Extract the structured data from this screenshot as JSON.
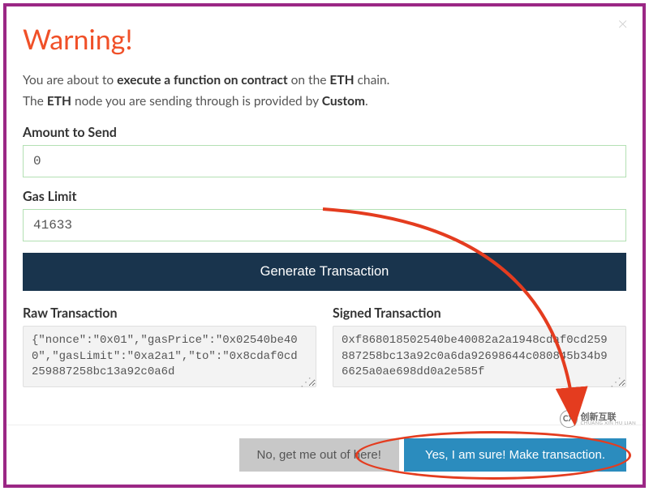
{
  "modal": {
    "title": "Warning!",
    "close_glyph": "×",
    "desc_line1_pre": "You are about to ",
    "desc_line1_bold": "execute a function on contract",
    "desc_line1_mid": " on the ",
    "desc_line1_chain": "ETH",
    "desc_line1_post": " chain.",
    "desc_line2_pre": "The ",
    "desc_line2_chain": "ETH",
    "desc_line2_mid": " node you are sending through is provided by ",
    "desc_line2_provider": "Custom",
    "desc_line2_post": "."
  },
  "fields": {
    "amount_label": "Amount to Send",
    "amount_value": "0",
    "gas_label": "Gas Limit",
    "gas_value": "41633"
  },
  "buttons": {
    "generate": "Generate Transaction",
    "cancel": "No, get me out of here!",
    "confirm": "Yes, I am sure! Make transaction."
  },
  "tx": {
    "raw_label": "Raw Transaction",
    "raw_value": "{\"nonce\":\"0x01\",\"gasPrice\":\"0x02540be400\",\"gasLimit\":\"0xa2a1\",\"to\":\"0x8cdaf0cd259887258bc13a92c0a6d",
    "signed_label": "Signed Transaction",
    "signed_value": "0xf868018502540be40082a2a1948cdaf0cd259887258bc13a92c0a6da92698644c080845b34b96625a0ae698dd0a2e585f"
  },
  "watermark": {
    "logo_letters": "CX",
    "cn": "创新互联",
    "en": "CHUANG XIN HU LIAN"
  }
}
